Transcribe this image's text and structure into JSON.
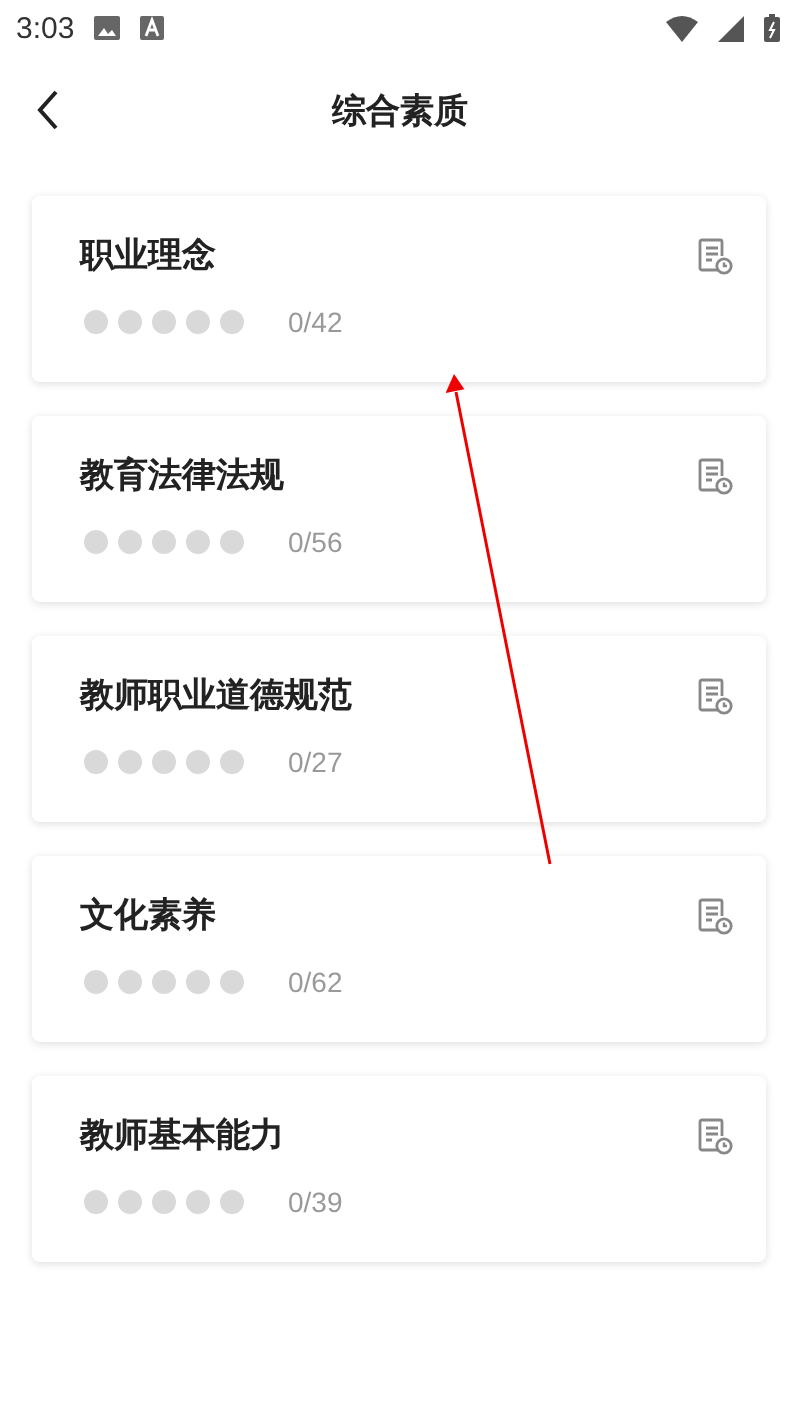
{
  "status_bar": {
    "time": "3:03"
  },
  "header": {
    "title": "综合素质"
  },
  "categories": [
    {
      "title": "职业理念",
      "stars": 0,
      "count": "0/42"
    },
    {
      "title": "教育法律法规",
      "stars": 0,
      "count": "0/56"
    },
    {
      "title": "教师职业道德规范",
      "stars": 0,
      "count": "0/27"
    },
    {
      "title": "文化素养",
      "stars": 0,
      "count": "0/62"
    },
    {
      "title": "教师基本能力",
      "stars": 0,
      "count": "0/39"
    }
  ]
}
